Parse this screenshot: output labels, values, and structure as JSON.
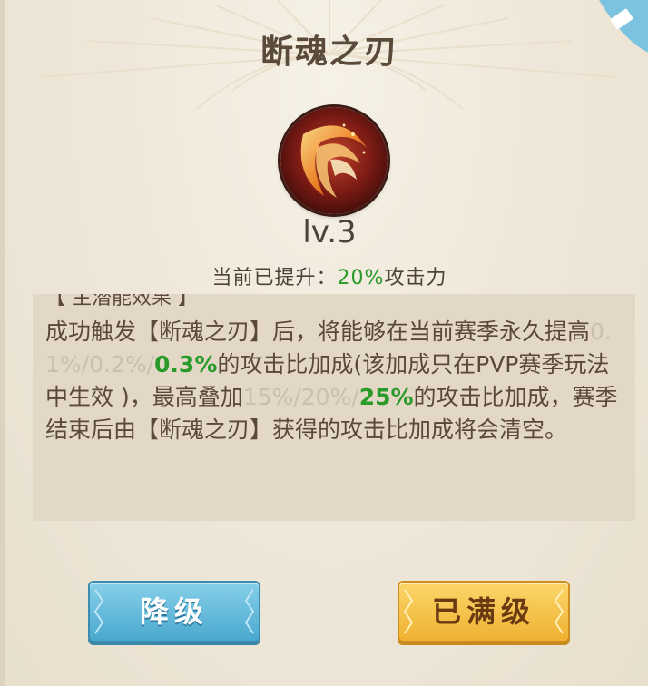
{
  "dialog": {
    "title": "断魂之刃",
    "level": "lv.3",
    "bonus_label": "当前已提升：",
    "bonus_value": "20%",
    "bonus_suffix": "攻击力"
  },
  "description": {
    "header": "【 主潜能效果 】",
    "p1": "成功触发【断魂之刃】后，将能够在当前赛季永久提高",
    "tier_faded_1": "0.1%/0.2%/",
    "tier_active_1": "0.3%",
    "p2": "的攻击比加成(该加成只在PVP赛季玩法中生效 )，最高叠加",
    "tier_faded_2": "15%/20%/",
    "tier_active_2": "25%",
    "p3": "的攻击比加成，赛季结束后由【断魂之刃】获得的攻击比加成将会清空。"
  },
  "buttons": {
    "downgrade": "降级",
    "maxed": "已满级"
  },
  "colors": {
    "highlight_green": "#2a9a2a",
    "downgrade_blue": "#4aa9cf",
    "maxed_yellow": "#f0b132"
  },
  "icons": {
    "skill": "flame-slash-icon",
    "corner": "diamond-corner-icon"
  }
}
